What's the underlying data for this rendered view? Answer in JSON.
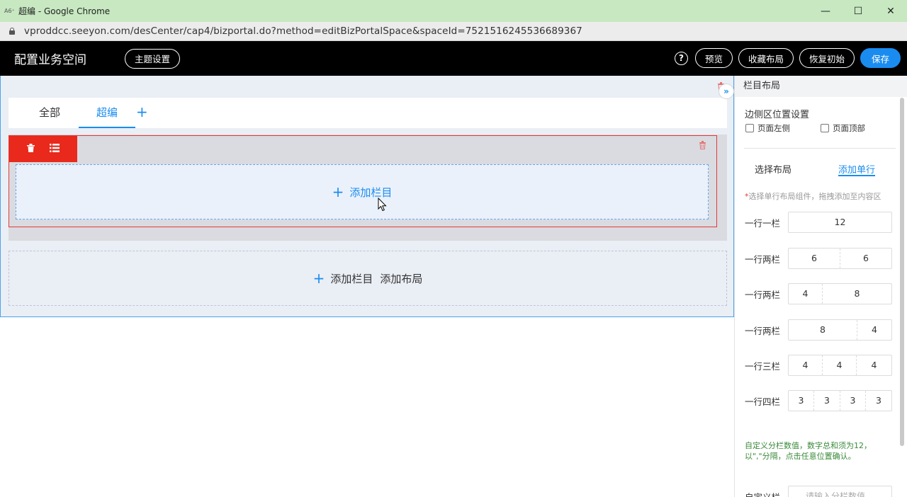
{
  "window": {
    "title": "超编 - Google Chrome",
    "controls": {
      "minimize": "—",
      "maximize": "☐",
      "close": "✕"
    }
  },
  "address": {
    "url": "vproddcc.seeyon.com/desCenter/cap4/bizportal.do?method=editBizPortalSpace&spaceId=7521516245536689367"
  },
  "header": {
    "title": "配置业务空间",
    "theme_btn": "主题设置",
    "help": "?",
    "preview_btn": "预览",
    "collect_btn": "收藏布局",
    "reset_btn": "恢复初始",
    "save_btn": "保存"
  },
  "editor": {
    "tabs": [
      {
        "label": "全部"
      },
      {
        "label": "超编"
      }
    ],
    "tab_add": "+",
    "add_column": "添加栏目",
    "add_column_bottom": "添加栏目",
    "add_layout": "添加布局",
    "plus": "+"
  },
  "panel": {
    "title": "栏目布局",
    "collapse": "»",
    "side_section": "边侧区位置设置",
    "chk_left": "页面左侧",
    "chk_top": "页面顶部",
    "tab_layout": "选择布局",
    "tab_row": "添加单行",
    "hint_star": "*",
    "hint": "选择单行布局组件，拖拽添加至内容区",
    "layouts": [
      {
        "label": "一行一栏",
        "cells": [
          "12"
        ]
      },
      {
        "label": "一行两栏",
        "cells": [
          "6",
          "6"
        ]
      },
      {
        "label": "一行两栏",
        "cells": [
          "4",
          "8"
        ]
      },
      {
        "label": "一行两栏",
        "cells": [
          "8",
          "4"
        ]
      },
      {
        "label": "一行三栏",
        "cells": [
          "4",
          "4",
          "4"
        ]
      },
      {
        "label": "一行四栏",
        "cells": [
          "3",
          "3",
          "3",
          "3"
        ]
      }
    ],
    "custom_hint": "自定义分栏数值，数字总和须为12，以\",\"分隔，点击任意位置确认。",
    "custom_label": "自定义栏",
    "custom_placeholder": "请输入分栏数值"
  },
  "colors": {
    "accent": "#1a8cf0",
    "danger": "#e8291c",
    "header_bg": "#000000",
    "titlebar_bg": "#c7e8c1"
  }
}
